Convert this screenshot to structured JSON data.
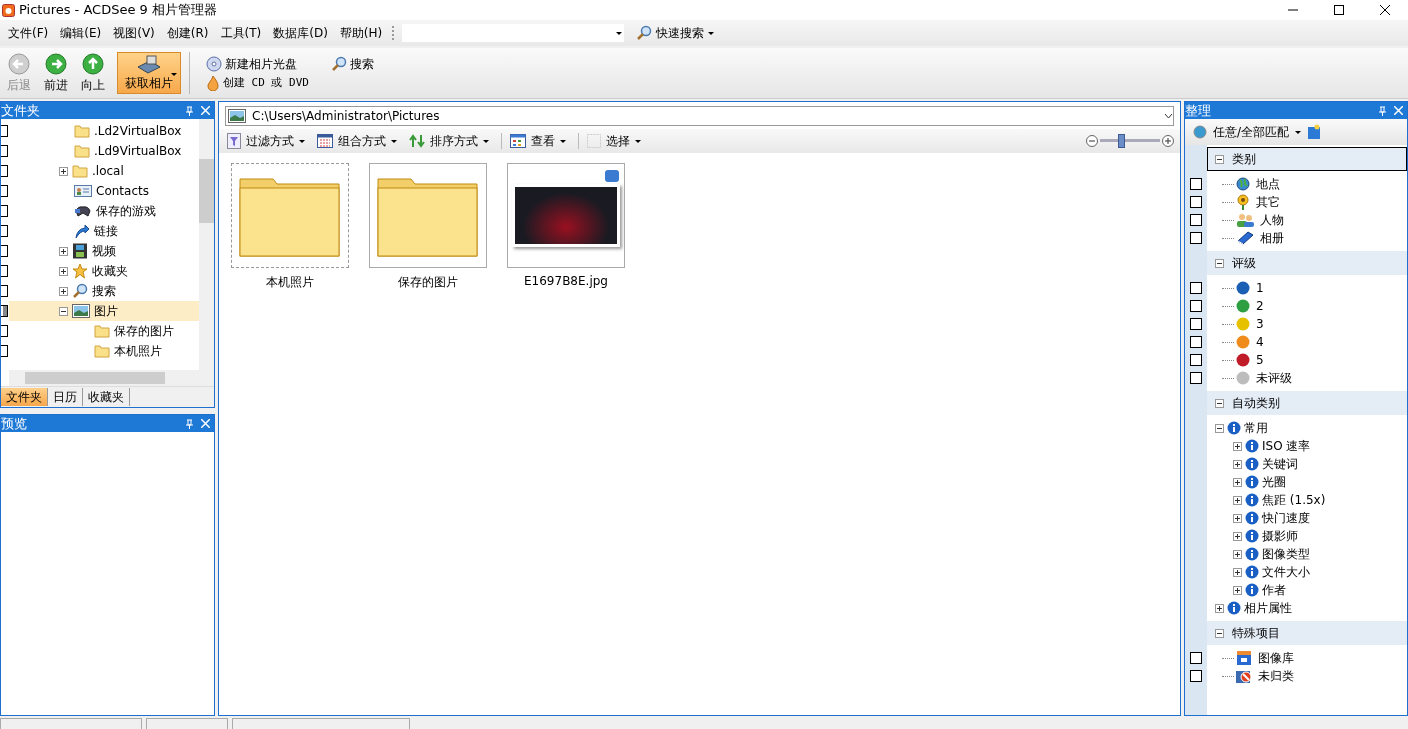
{
  "window": {
    "title": "Pictures - ACDSee 9 相片管理器"
  },
  "menu": [
    "文件(F)",
    "编辑(E)",
    "视图(V)",
    "创建(R)",
    "工具(T)",
    "数据库(D)",
    "帮助(H)"
  ],
  "quick_search": {
    "label": "快速搜索"
  },
  "toolbar": {
    "nav": [
      {
        "label": "后退",
        "kind": "back",
        "disabled": true
      },
      {
        "label": "前进",
        "kind": "forward",
        "disabled": false
      },
      {
        "label": "向上",
        "kind": "up",
        "disabled": false
      }
    ],
    "acquire": {
      "label": "获取相片"
    },
    "actions": [
      {
        "label": "新建相片光盘",
        "kind": "disc"
      },
      {
        "label": "创建 CD 或 DVD",
        "kind": "burn"
      },
      {
        "label": "搜索",
        "kind": "search"
      }
    ]
  },
  "folders_panel": {
    "title": "文件夹",
    "tree": [
      {
        "label": ".Ld2VirtualBox",
        "kind": "folder",
        "mixed": false,
        "selected": false
      },
      {
        "label": ".Ld9VirtualBox",
        "kind": "folder",
        "mixed": false,
        "selected": false
      },
      {
        "label": ".local",
        "kind": "folder",
        "mixed": false,
        "expanded": false,
        "selected": false
      },
      {
        "label": "Contacts",
        "kind": "contacts",
        "mixed": false,
        "selected": false
      },
      {
        "label": "保存的游戏",
        "kind": "games",
        "mixed": false,
        "selected": false
      },
      {
        "label": "链接",
        "kind": "link",
        "mixed": false,
        "selected": false
      },
      {
        "label": "视频",
        "kind": "video",
        "mixed": false,
        "expanded": false,
        "selected": false
      },
      {
        "label": "收藏夹",
        "kind": "star",
        "mixed": false,
        "expanded": false,
        "selected": false
      },
      {
        "label": "搜索",
        "kind": "search",
        "mixed": false,
        "expanded": false,
        "selected": false
      },
      {
        "label": "图片",
        "kind": "pictures",
        "mixed": true,
        "expanded": true,
        "selected": true,
        "children": [
          {
            "label": "保存的图片",
            "kind": "folder",
            "mixed": false,
            "selected": false
          },
          {
            "label": "本机照片",
            "kind": "folder",
            "mixed": false,
            "selected": false
          }
        ]
      }
    ],
    "tabs": [
      {
        "label": "文件夹",
        "selected": true
      },
      {
        "label": "日历",
        "selected": false
      },
      {
        "label": "收藏夹",
        "selected": false
      }
    ]
  },
  "preview_panel": {
    "title": "预览"
  },
  "browser": {
    "path": "C:\\Users\\Administrator\\Pictures",
    "tools": [
      {
        "label": "过滤方式",
        "kind": "filter"
      },
      {
        "label": "组合方式",
        "kind": "group"
      },
      {
        "label": "排序方式",
        "kind": "sort"
      },
      {
        "label": "查看",
        "kind": "view"
      },
      {
        "label": "选择",
        "kind": "select"
      }
    ],
    "zoom": {
      "level": 0.35
    },
    "items": [
      {
        "name": "本机照片",
        "kind": "folder",
        "focused": true
      },
      {
        "name": "保存的图片",
        "kind": "folder",
        "focused": false
      },
      {
        "name": "E1697B8E.jpg",
        "kind": "image",
        "focused": false
      }
    ]
  },
  "organize_panel": {
    "title": "整理",
    "match": "任意/全部匹配",
    "sections": [
      {
        "title": "类别",
        "expanded": true,
        "focused": true,
        "items": [
          {
            "label": "地点",
            "kind": "globe",
            "checked": false
          },
          {
            "label": "其它",
            "kind": "flower",
            "checked": false
          },
          {
            "label": "人物",
            "kind": "people",
            "checked": false
          },
          {
            "label": "相册",
            "kind": "album",
            "checked": false
          }
        ]
      },
      {
        "title": "评级",
        "expanded": true,
        "focused": false,
        "items": [
          {
            "label": "1",
            "kind": "rating",
            "color": "#1a5fb4",
            "checked": false
          },
          {
            "label": "2",
            "kind": "rating",
            "color": "#2ea043",
            "checked": false
          },
          {
            "label": "3",
            "kind": "rating",
            "color": "#e5c100",
            "checked": false
          },
          {
            "label": "4",
            "kind": "rating",
            "color": "#f08c1c",
            "checked": false
          },
          {
            "label": "5",
            "kind": "rating",
            "color": "#c01c28",
            "checked": false
          },
          {
            "label": "未评级",
            "kind": "rating",
            "color": "#bdbdbd",
            "checked": false
          }
        ]
      },
      {
        "title": "自动类别",
        "expanded": true,
        "focused": false,
        "tree": [
          {
            "label": "常用",
            "expanded": true,
            "children": [
              {
                "label": "ISO 速率",
                "expanded": false
              },
              {
                "label": "关键词",
                "expanded": false
              },
              {
                "label": "光圈",
                "expanded": false
              },
              {
                "label": "焦距 (1.5x)",
                "expanded": false
              },
              {
                "label": "快门速度",
                "expanded": false
              },
              {
                "label": "摄影师",
                "expanded": false
              },
              {
                "label": "图像类型",
                "expanded": false
              },
              {
                "label": "文件大小",
                "expanded": false
              },
              {
                "label": "作者",
                "expanded": false
              }
            ]
          },
          {
            "label": "相片属性",
            "expanded": false
          }
        ]
      },
      {
        "title": "特殊项目",
        "expanded": true,
        "focused": false,
        "items": [
          {
            "label": "图像库",
            "kind": "library",
            "checked": false
          },
          {
            "label": "未归类",
            "kind": "uncategorized",
            "checked": false
          }
        ]
      }
    ]
  }
}
